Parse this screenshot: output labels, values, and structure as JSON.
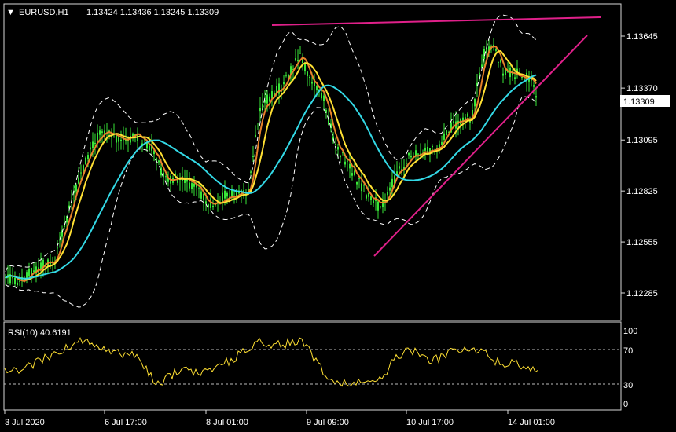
{
  "header": {
    "menu_glyph": "▼",
    "symbol_tf": "EURUSD,H1",
    "ohlc": "1.13424 1.13436 1.13245 1.13309"
  },
  "price_axis": {
    "labels": [
      "1.13645",
      "1.13370",
      "1.13095",
      "1.12825",
      "1.12555",
      "1.12285"
    ],
    "values": [
      1.13645,
      1.1337,
      1.13095,
      1.12825,
      1.12555,
      1.12285
    ],
    "current_price": "1.13309",
    "current_value": 1.13309
  },
  "rsi": {
    "title": "RSI(10) 40.6191",
    "levels": [
      "100",
      "70",
      "30",
      "0"
    ]
  },
  "time_axis": {
    "labels": [
      "3 Jul 2020",
      "6 Jul 17:00",
      "8 Jul 01:00",
      "9 Jul 09:00",
      "10 Jul 17:00",
      "14 Jul 01:00"
    ]
  },
  "colors": {
    "candles": "#39e639",
    "ma_fast": "#e8832a",
    "ma_mid": "#ffe033",
    "ma_slow": "#33d9e6",
    "bands": "#ffffff",
    "trendline": "#e0208a",
    "rsi_line": "#ffe033",
    "grid": "#ffffff"
  },
  "chart_data": {
    "type": "line",
    "symbol": "EURUSD",
    "timeframe": "H1",
    "y_range": [
      1.1222,
      1.1377
    ],
    "series": [
      {
        "name": "EURUSD,H1",
        "x": [
          "3 Jul 2020",
          "6 Jul 17:00",
          "8 Jul 01:00",
          "9 Jul 09:00",
          "10 Jul 17:00",
          "14 Jul 01:00"
        ],
        "y": [
          1.1238,
          1.131,
          1.1285,
          1.135,
          1.13,
          1.134
        ]
      }
    ],
    "rsi_levels": [
      70,
      30
    ],
    "rsi_range": [
      0,
      100
    ]
  }
}
